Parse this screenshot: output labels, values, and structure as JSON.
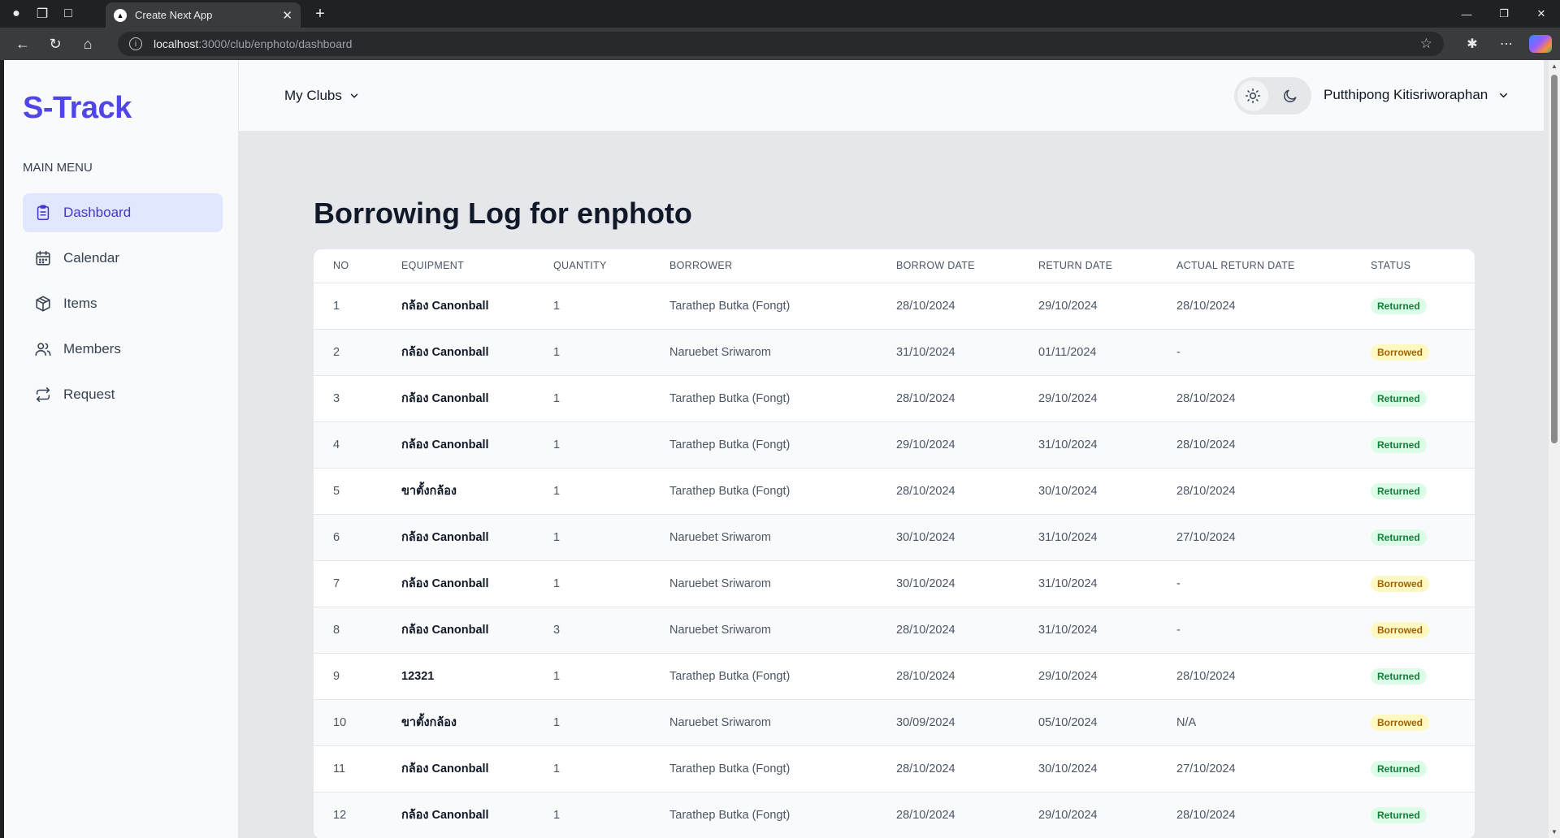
{
  "browser": {
    "tab_title": "Create Next App",
    "url_host": "localhost",
    "url_path": ":3000/club/enphoto/dashboard"
  },
  "sidebar": {
    "logo": "S-Track",
    "menu_label": "MAIN MENU",
    "items": [
      {
        "label": "Dashboard",
        "icon": "clipboard-icon",
        "active": true
      },
      {
        "label": "Calendar",
        "icon": "calendar-icon",
        "active": false
      },
      {
        "label": "Items",
        "icon": "box-icon",
        "active": false
      },
      {
        "label": "Members",
        "icon": "users-icon",
        "active": false
      },
      {
        "label": "Request",
        "icon": "arrows-repeat-icon",
        "active": false
      }
    ]
  },
  "topbar": {
    "clubs_label": "My Clubs",
    "user_name": "Putthipong Kitisriworaphan"
  },
  "main": {
    "title": "Borrowing Log for enphoto",
    "columns": [
      "NO",
      "EQUIPMENT",
      "QUANTITY",
      "BORROWER",
      "BORROW DATE",
      "RETURN DATE",
      "ACTUAL RETURN DATE",
      "STATUS"
    ],
    "rows": [
      {
        "no": "1",
        "equipment": "กล้อง Canonball",
        "quantity": "1",
        "borrower": "Tarathep Butka (Fongt)",
        "borrow_date": "28/10/2024",
        "return_date": "29/10/2024",
        "actual_return_date": "28/10/2024",
        "status": "Returned"
      },
      {
        "no": "2",
        "equipment": "กล้อง Canonball",
        "quantity": "1",
        "borrower": "Naruebet Sriwarom",
        "borrow_date": "31/10/2024",
        "return_date": "01/11/2024",
        "actual_return_date": "-",
        "status": "Borrowed"
      },
      {
        "no": "3",
        "equipment": "กล้อง Canonball",
        "quantity": "1",
        "borrower": "Tarathep Butka (Fongt)",
        "borrow_date": "28/10/2024",
        "return_date": "29/10/2024",
        "actual_return_date": "28/10/2024",
        "status": "Returned"
      },
      {
        "no": "4",
        "equipment": "กล้อง Canonball",
        "quantity": "1",
        "borrower": "Tarathep Butka (Fongt)",
        "borrow_date": "29/10/2024",
        "return_date": "31/10/2024",
        "actual_return_date": "28/10/2024",
        "status": "Returned"
      },
      {
        "no": "5",
        "equipment": "ขาตั้งกล้อง",
        "quantity": "1",
        "borrower": "Tarathep Butka (Fongt)",
        "borrow_date": "28/10/2024",
        "return_date": "30/10/2024",
        "actual_return_date": "28/10/2024",
        "status": "Returned"
      },
      {
        "no": "6",
        "equipment": "กล้อง Canonball",
        "quantity": "1",
        "borrower": "Naruebet Sriwarom",
        "borrow_date": "30/10/2024",
        "return_date": "31/10/2024",
        "actual_return_date": "27/10/2024",
        "status": "Returned"
      },
      {
        "no": "7",
        "equipment": "กล้อง Canonball",
        "quantity": "1",
        "borrower": "Naruebet Sriwarom",
        "borrow_date": "30/10/2024",
        "return_date": "31/10/2024",
        "actual_return_date": "-",
        "status": "Borrowed"
      },
      {
        "no": "8",
        "equipment": "กล้อง Canonball",
        "quantity": "3",
        "borrower": "Naruebet Sriwarom",
        "borrow_date": "28/10/2024",
        "return_date": "31/10/2024",
        "actual_return_date": "-",
        "status": "Borrowed"
      },
      {
        "no": "9",
        "equipment": "12321",
        "quantity": "1",
        "borrower": "Tarathep Butka (Fongt)",
        "borrow_date": "28/10/2024",
        "return_date": "29/10/2024",
        "actual_return_date": "28/10/2024",
        "status": "Returned"
      },
      {
        "no": "10",
        "equipment": "ขาตั้งกล้อง",
        "quantity": "1",
        "borrower": "Naruebet Sriwarom",
        "borrow_date": "30/09/2024",
        "return_date": "05/10/2024",
        "actual_return_date": "N/A",
        "status": "Borrowed"
      },
      {
        "no": "11",
        "equipment": "กล้อง Canonball",
        "quantity": "1",
        "borrower": "Tarathep Butka (Fongt)",
        "borrow_date": "28/10/2024",
        "return_date": "30/10/2024",
        "actual_return_date": "27/10/2024",
        "status": "Returned"
      },
      {
        "no": "12",
        "equipment": "กล้อง Canonball",
        "quantity": "1",
        "borrower": "Tarathep Butka (Fongt)",
        "borrow_date": "28/10/2024",
        "return_date": "29/10/2024",
        "actual_return_date": "28/10/2024",
        "status": "Returned"
      }
    ]
  },
  "colors": {
    "accent": "#4f46e5",
    "returned_bg": "#dcfce7",
    "returned_text": "#15803d",
    "borrowed_bg": "#fef9c3",
    "borrowed_text": "#a16207"
  }
}
